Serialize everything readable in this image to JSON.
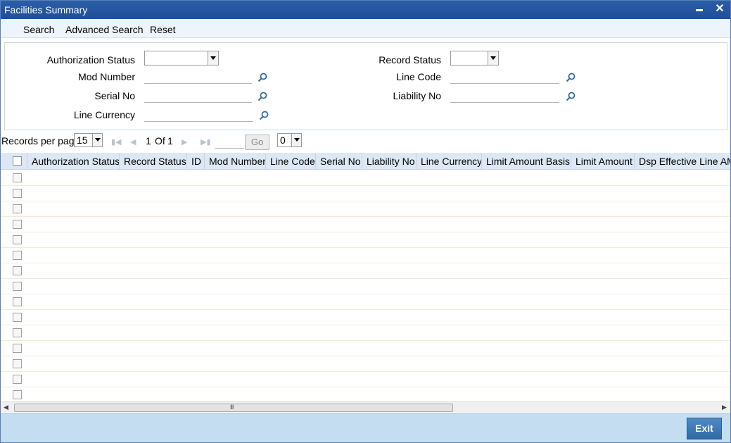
{
  "window": {
    "title": "Facilities Summary"
  },
  "menu": {
    "search": "Search",
    "advanced_search": "Advanced Search",
    "reset": "Reset"
  },
  "criteria": {
    "authorization_status": {
      "label": "Authorization Status",
      "value": ""
    },
    "mod_number": {
      "label": "Mod Number",
      "value": ""
    },
    "serial_no": {
      "label": "Serial No",
      "value": ""
    },
    "line_currency": {
      "label": "Line Currency",
      "value": ""
    },
    "record_status": {
      "label": "Record Status",
      "value": ""
    },
    "line_code": {
      "label": "Line Code",
      "value": ""
    },
    "liability_no": {
      "label": "Liability No",
      "value": ""
    }
  },
  "pager": {
    "records_per_page_label": "Records per page",
    "records_per_page": "15",
    "current_page": "1",
    "of_label": "Of",
    "total_pages": "1",
    "go_label": "Go",
    "jump_value": "0"
  },
  "grid": {
    "columns": [
      "Authorization Status",
      "Record Status",
      "ID",
      "Mod Number",
      "Line Code",
      "Serial No",
      "Liability No",
      "Line Currency",
      "Limit Amount Basis",
      "Limit Amount",
      "Dsp Effective Line AMO"
    ],
    "empty_row_count": 15
  },
  "footer": {
    "exit_label": "Exit"
  },
  "icons": {
    "lookup": "magnifier-icon",
    "first": "first-page-icon",
    "prev": "prev-page-icon",
    "next": "next-page-icon",
    "last": "last-page-icon"
  },
  "colors": {
    "titlebar": "#2b5ea8",
    "footer": "#c4ddf0",
    "header": "#dde8f4"
  }
}
